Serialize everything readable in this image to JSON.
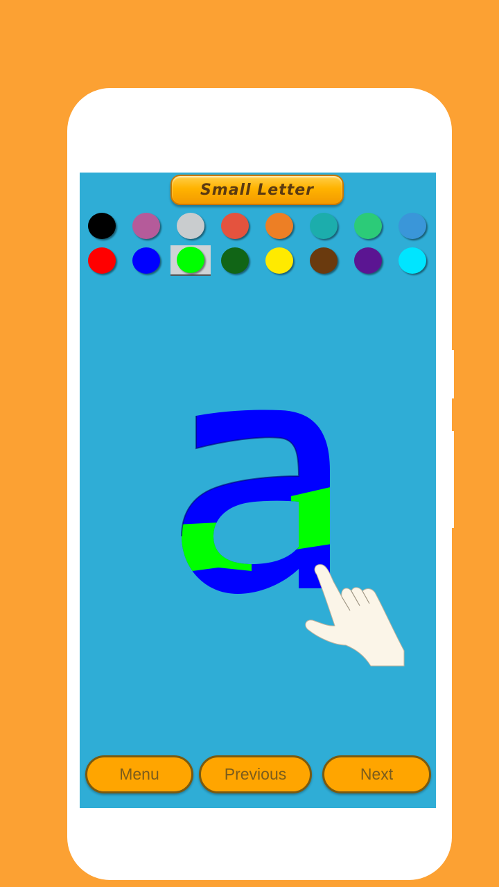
{
  "background_color": "#fca133",
  "screen_color": "#2fadd6",
  "header": {
    "title": "Small Letter"
  },
  "palette": {
    "selected_index": 10,
    "colors": [
      {
        "name": "black",
        "hex": "#000000"
      },
      {
        "name": "pink",
        "hex": "#b55b9a"
      },
      {
        "name": "light-gray",
        "hex": "#c9ccce"
      },
      {
        "name": "coral-red",
        "hex": "#e4533e"
      },
      {
        "name": "orange",
        "hex": "#ed7f25"
      },
      {
        "name": "teal",
        "hex": "#1cadac"
      },
      {
        "name": "emerald",
        "hex": "#2ccb78"
      },
      {
        "name": "sky-blue",
        "hex": "#3a96d9"
      },
      {
        "name": "red",
        "hex": "#ff0000"
      },
      {
        "name": "blue",
        "hex": "#0000ff"
      },
      {
        "name": "green",
        "hex": "#00ff00"
      },
      {
        "name": "dark-green",
        "hex": "#116516"
      },
      {
        "name": "yellow",
        "hex": "#ffea00"
      },
      {
        "name": "brown",
        "hex": "#6a3a0e"
      },
      {
        "name": "purple",
        "hex": "#5b1592"
      },
      {
        "name": "cyan",
        "hex": "#00e5ff"
      }
    ]
  },
  "canvas": {
    "letter": "a",
    "stroke_colors": {
      "primary": "#0000ff",
      "secondary": "#00ff00"
    }
  },
  "nav": {
    "menu_label": "Menu",
    "previous_label": "Previous",
    "next_label": "Next"
  }
}
